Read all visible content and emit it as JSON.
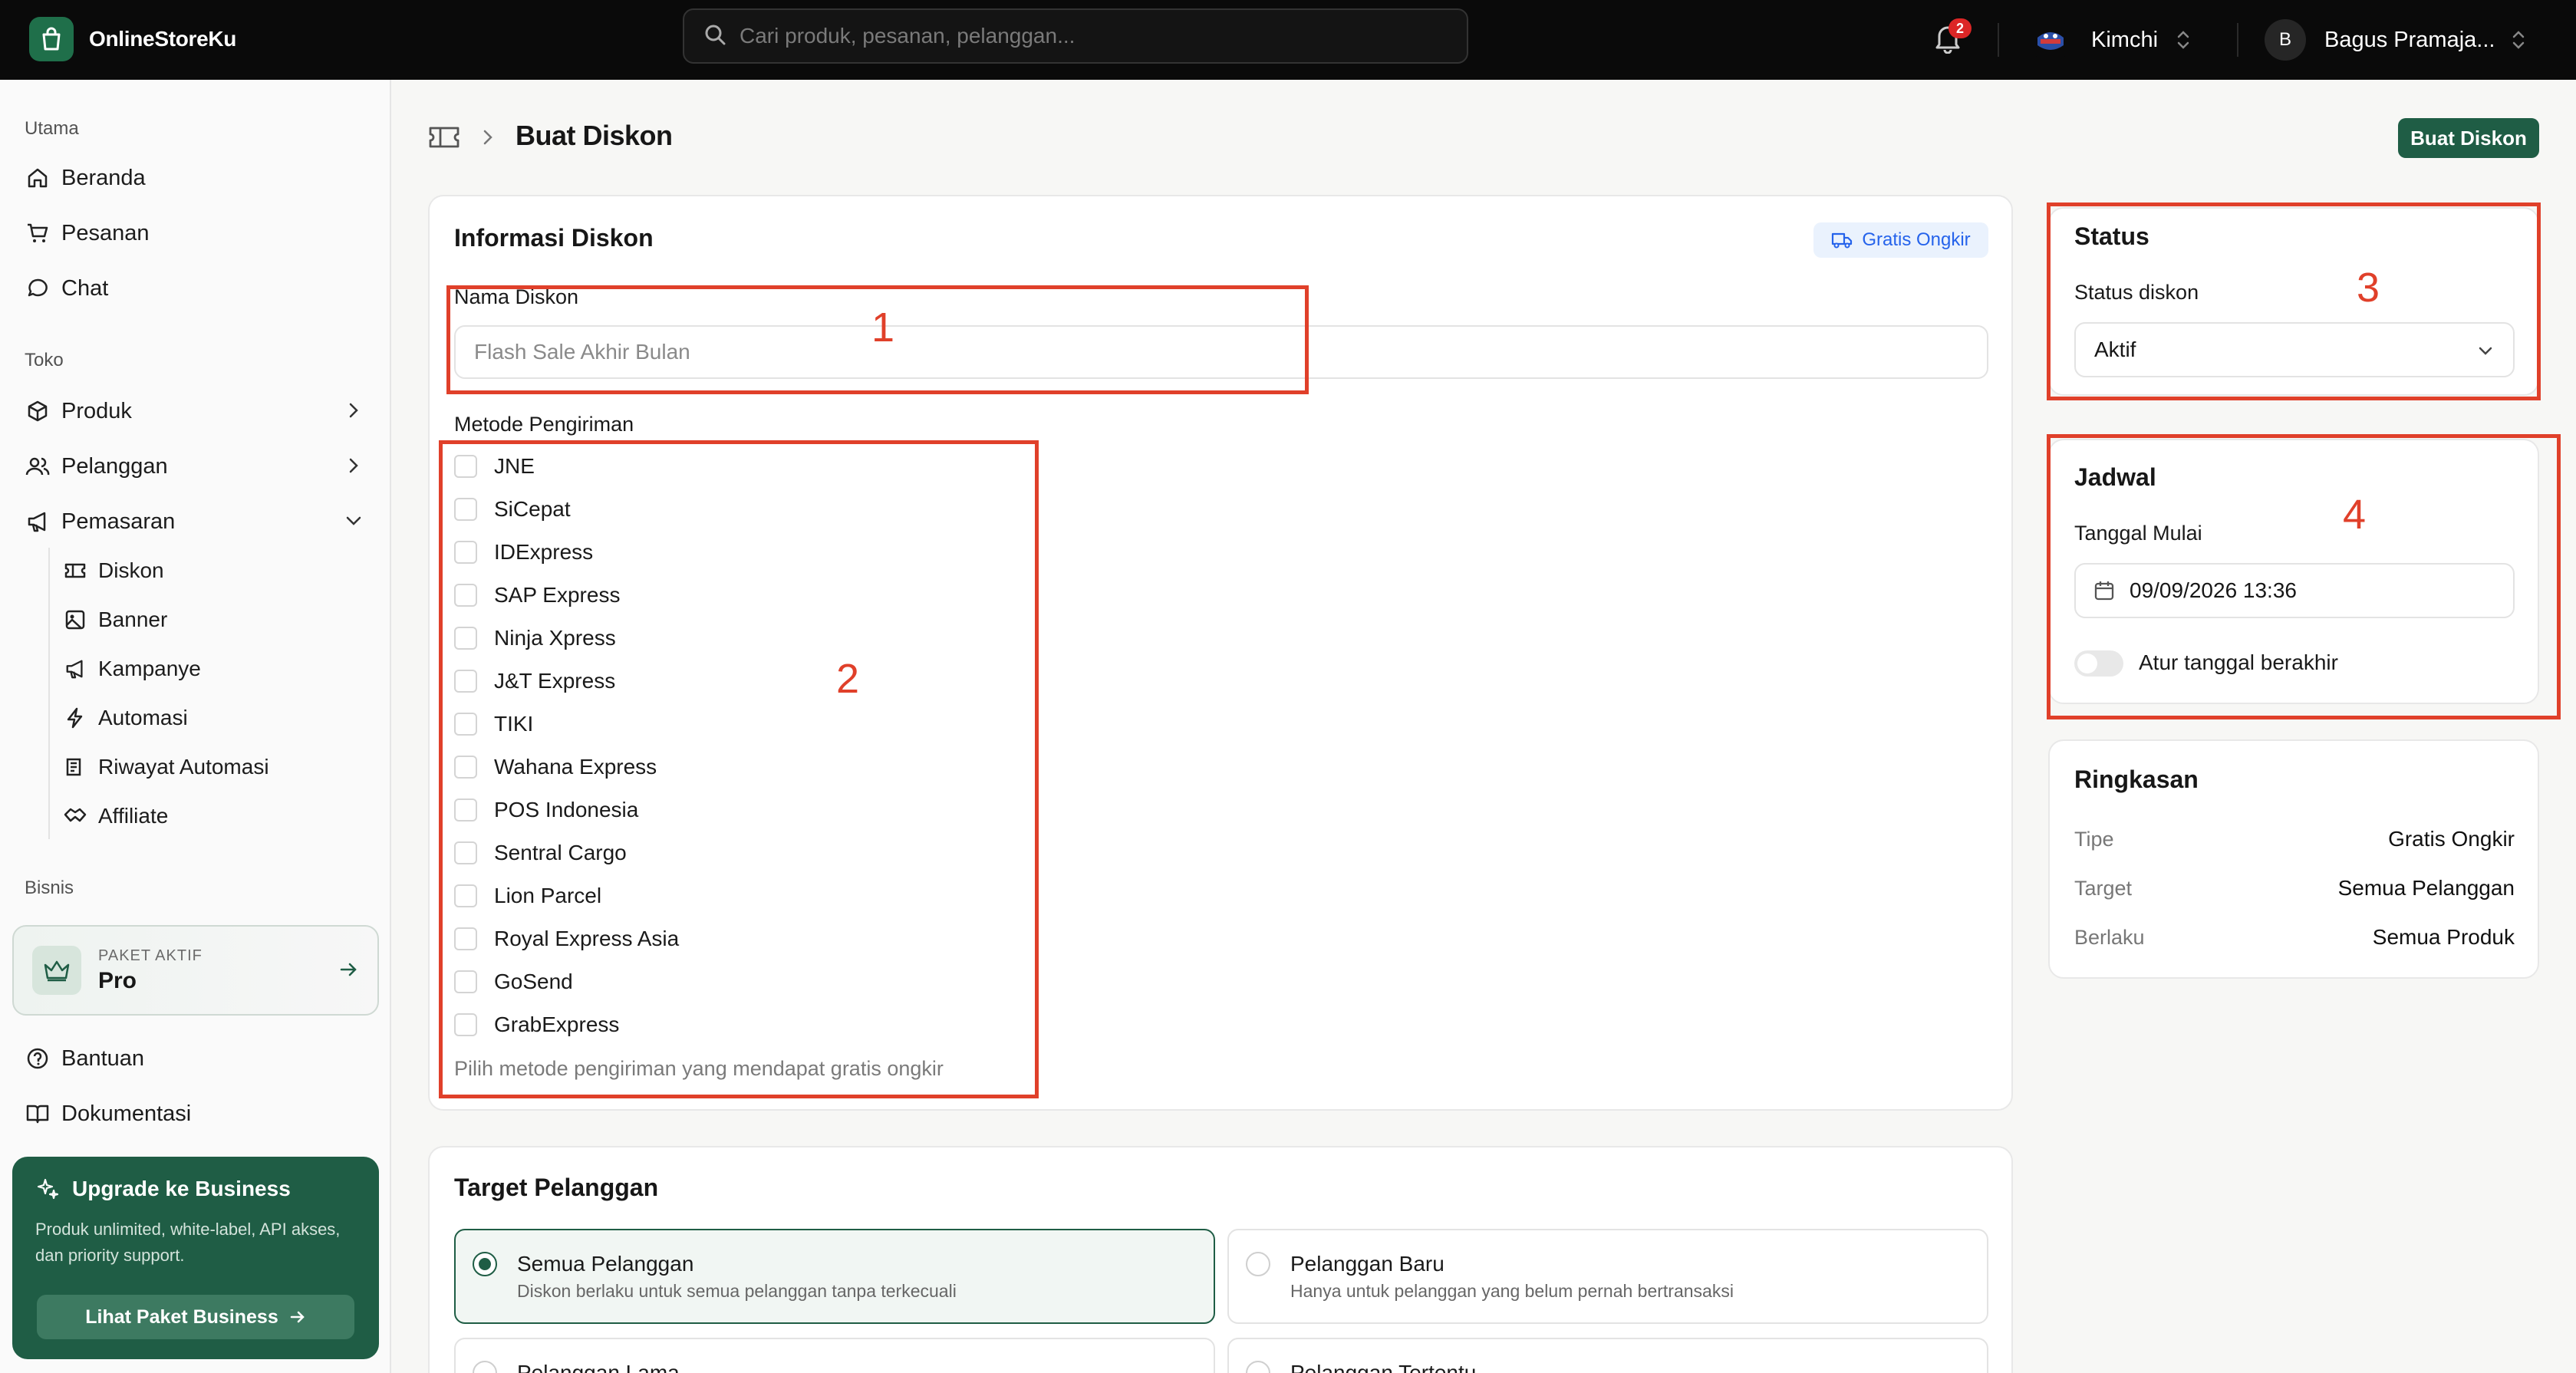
{
  "app": {
    "name": "OnlineStoreKu"
  },
  "search": {
    "placeholder": "Cari produk, pesanan, pelanggan..."
  },
  "notifications": {
    "count": "2"
  },
  "store": {
    "name": "Kimchi"
  },
  "user": {
    "initial": "B",
    "name": "Bagus Pramaja..."
  },
  "sidebar": {
    "section_main": "Utama",
    "main_items": [
      "Beranda",
      "Pesanan",
      "Chat"
    ],
    "section_store": "Toko",
    "store_items": [
      "Produk",
      "Pelanggan",
      "Pemasaran"
    ],
    "marketing_sub": [
      "Diskon",
      "Banner",
      "Kampanye",
      "Automasi",
      "Riwayat Automasi",
      "Affiliate"
    ],
    "section_business": "Bisnis",
    "plan": {
      "label": "PAKET AKTIF",
      "name": "Pro"
    },
    "help_items": [
      "Bantuan",
      "Dokumentasi"
    ],
    "upgrade": {
      "title": "Upgrade ke Business",
      "desc": "Produk unlimited, white-label, API akses, dan priority support.",
      "button": "Lihat Paket Business"
    }
  },
  "header": {
    "title": "Buat Diskon",
    "action": "Buat Diskon"
  },
  "discount_info": {
    "title": "Informasi Diskon",
    "type_badge": "Gratis Ongkir",
    "name_label": "Nama Diskon",
    "name_placeholder": "Flash Sale Akhir Bulan",
    "shipping_label": "Metode Pengiriman",
    "shipping_methods": [
      "JNE",
      "SiCepat",
      "IDExpress",
      "SAP Express",
      "Ninja Xpress",
      "J&T Express",
      "TIKI",
      "Wahana Express",
      "POS Indonesia",
      "Sentral Cargo",
      "Lion Parcel",
      "Royal Express Asia",
      "GoSend",
      "GrabExpress"
    ],
    "shipping_hint": "Pilih metode pengiriman yang mendapat gratis ongkir"
  },
  "target": {
    "title": "Target Pelanggan",
    "options": [
      {
        "title": "Semua Pelanggan",
        "desc": "Diskon berlaku untuk semua pelanggan tanpa terkecuali",
        "selected": true
      },
      {
        "title": "Pelanggan Baru",
        "desc": "Hanya untuk pelanggan yang belum pernah bertransaksi",
        "selected": false
      },
      {
        "title": "Pelanggan Lama",
        "desc": "",
        "selected": false
      },
      {
        "title": "Pelanggan Tertentu",
        "desc": "",
        "selected": false
      }
    ]
  },
  "status": {
    "title": "Status",
    "label": "Status diskon",
    "value": "Aktif"
  },
  "schedule": {
    "title": "Jadwal",
    "start_label": "Tanggal Mulai",
    "start_value": "09/09/2026 13:36",
    "end_toggle_label": "Atur tanggal berakhir",
    "end_enabled": false
  },
  "summary": {
    "title": "Ringkasan",
    "rows": [
      {
        "key": "Tipe",
        "value": "Gratis Ongkir"
      },
      {
        "key": "Target",
        "value": "Semua Pelanggan"
      },
      {
        "key": "Berlaku",
        "value": "Semua Produk"
      }
    ]
  },
  "annotations": [
    "1",
    "2",
    "3",
    "4"
  ],
  "colors": {
    "brand": "#1f5d45",
    "annotation": "#e0402a",
    "badge_text": "#2563eb",
    "notification": "#dc2626"
  }
}
